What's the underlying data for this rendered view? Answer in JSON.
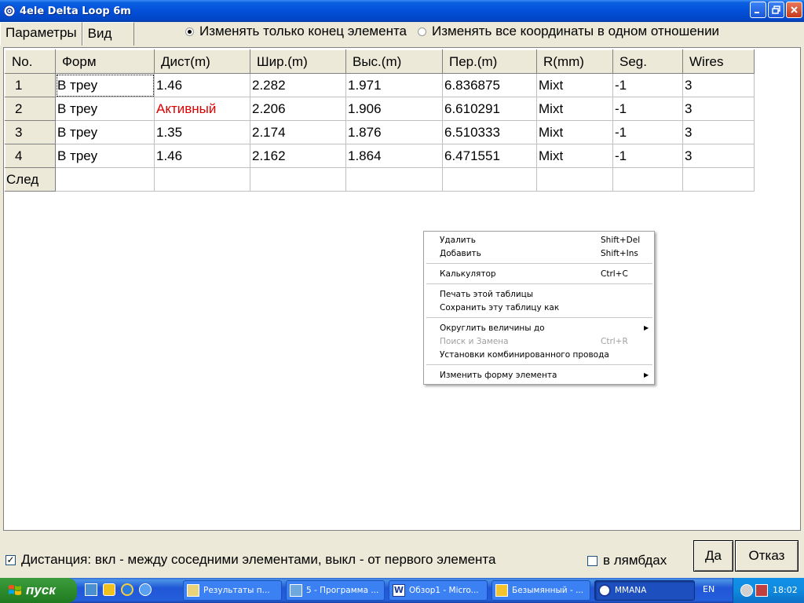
{
  "window": {
    "title": "4ele Delta Loop 6m"
  },
  "tabs": [
    {
      "label": "Параметры"
    },
    {
      "label": "Вид"
    }
  ],
  "radios": [
    {
      "label": "Изменять только конец элемента",
      "checked": true
    },
    {
      "label": "Изменять все координаты в одном отношении",
      "checked": false
    }
  ],
  "table": {
    "headers": [
      "No.",
      "Форм",
      "Дист(m)",
      "Шир.(m)",
      "Выс.(m)",
      "Пер.(m)",
      "R(mm)",
      "Seg.",
      "Wires"
    ],
    "rows": [
      [
        "1",
        "В треу",
        "1.46",
        "2.282",
        "1.971",
        "6.836875",
        "Mixt",
        "-1",
        "3"
      ],
      [
        "2",
        "В треу",
        "Активный",
        "2.206",
        "1.906",
        "6.610291",
        "Mixt",
        "-1",
        "3"
      ],
      [
        "3",
        "В треу",
        "1.35",
        "2.174",
        "1.876",
        "6.510333",
        "Mixt",
        "-1",
        "3"
      ],
      [
        "4",
        "В треу",
        "1.46",
        "2.162",
        "1.864",
        "6.471551",
        "Mixt",
        "-1",
        "3"
      ],
      [
        "След",
        "",
        "",
        "",
        "",
        "",
        "",
        "",
        ""
      ]
    ],
    "highlight_color": "#e00000"
  },
  "context_menu": {
    "items": [
      {
        "label": "Удалить",
        "shortcut": "Shift+Del"
      },
      {
        "label": "Добавить",
        "shortcut": "Shift+Ins"
      },
      {
        "label": "Калькулятор",
        "shortcut": "Ctrl+C"
      },
      {
        "label": "Печать этой таблицы",
        "shortcut": ""
      },
      {
        "label": "Сохранить эту таблицу как",
        "shortcut": ""
      },
      {
        "label": "Округлить величины до",
        "shortcut": ""
      },
      {
        "label": "Поиск и Замена",
        "shortcut": "Ctrl+R"
      },
      {
        "label": "Установки комбинированного провода",
        "shortcut": ""
      },
      {
        "label": "Изменить форму элемента",
        "shortcut": ""
      }
    ]
  },
  "bottom": {
    "distance_checkbox": {
      "label": "Дистанция: вкл - между соседними элементами, выкл - от первого элемента",
      "checked": true
    },
    "lambda_checkbox": {
      "label": "в лямбдах",
      "checked": false
    },
    "ok_label": "Да",
    "cancel_label": "Отказ"
  },
  "taskbar": {
    "start_label": "пуск",
    "tasks": [
      {
        "label": "Результаты п...",
        "icon": "folder-icon"
      },
      {
        "label": "5 - Программа ...",
        "icon": "image-icon"
      },
      {
        "label": "Обзор1 - Micro...",
        "icon": "word-icon"
      },
      {
        "label": "Безымянный - ...",
        "icon": "paint-icon"
      },
      {
        "label": "MMANA",
        "icon": "mmana-icon"
      }
    ],
    "language": "EN",
    "clock": "18:02"
  }
}
